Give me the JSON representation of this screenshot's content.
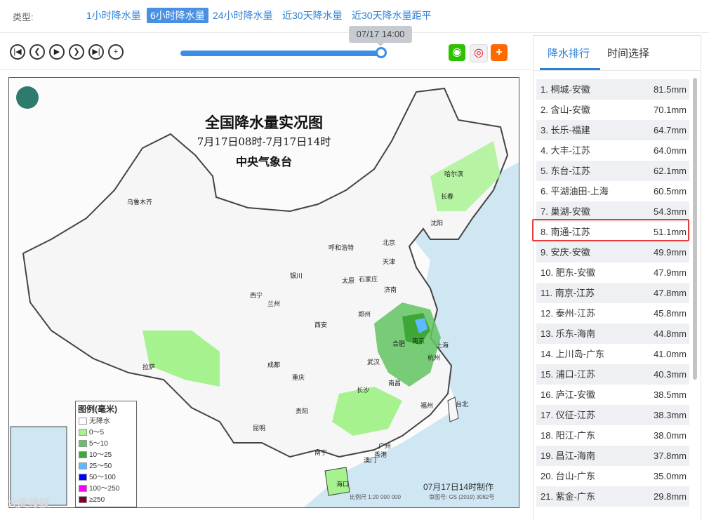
{
  "filter": {
    "label": "类型:",
    "options": [
      {
        "label": "1小时降水量"
      },
      {
        "label": "6小时降水量"
      },
      {
        "label": "24小时降水量"
      },
      {
        "label": "近30天降水量"
      },
      {
        "label": "近30天降水量距平"
      }
    ],
    "active_index": 1
  },
  "player": {
    "time_tooltip": "07/17 14:00",
    "progress": 1.0,
    "controls": [
      "first-icon",
      "prev-icon",
      "play-icon",
      "next-icon",
      "last-icon",
      "zoom-in-icon"
    ]
  },
  "share": {
    "icons": [
      "wechat-icon",
      "weibo-icon",
      "add-icon"
    ],
    "colors": [
      "#2dc100",
      "#e6162d",
      "#ff6a00"
    ]
  },
  "map": {
    "title": "全国降水量实况图",
    "subtitle": "7月17日08时-7月17日14时",
    "agency": "中央气象台",
    "made": "07月17日14时制作",
    "scale": "比例尺 1:20 000 000",
    "review": "审图号: GS (2019) 3082号",
    "legend": {
      "title": "图例(毫米)",
      "items": [
        {
          "label": "无降水",
          "color": "#ffffff"
        },
        {
          "label": "0～5",
          "color": "#a6f28f"
        },
        {
          "label": "5～10",
          "color": "#62c360"
        },
        {
          "label": "10～25",
          "color": "#3da836"
        },
        {
          "label": "25～50",
          "color": "#60b8ff"
        },
        {
          "label": "50～100",
          "color": "#0000fe"
        },
        {
          "label": "100～250",
          "color": "#fa00fa"
        },
        {
          "label": "≥250",
          "color": "#7f0030"
        }
      ]
    },
    "cities": [
      "乌鲁木齐",
      "哈尔滨",
      "长春",
      "沈阳",
      "呼和浩特",
      "北京",
      "天津",
      "石家庄",
      "太原",
      "银川",
      "济南",
      "西宁",
      "兰州",
      "郑州",
      "西安",
      "合肥",
      "南京",
      "上海",
      "拉萨",
      "成都",
      "武汉",
      "杭州",
      "重庆",
      "长沙",
      "南昌",
      "福州",
      "贵阳",
      "台北",
      "昆明",
      "广州",
      "南宁",
      "香港",
      "澳门",
      "海口"
    ]
  },
  "panel": {
    "tabs": [
      {
        "label": "降水排行"
      },
      {
        "label": "时间选择"
      }
    ],
    "rank_list": [
      {
        "name": "1. 桐城-安徽",
        "value": "81.5mm"
      },
      {
        "name": "2. 含山-安徽",
        "value": "70.1mm"
      },
      {
        "name": "3. 长乐-福建",
        "value": "64.7mm"
      },
      {
        "name": "4. 大丰-江苏",
        "value": "64.0mm"
      },
      {
        "name": "5. 东台-江苏",
        "value": "62.1mm"
      },
      {
        "name": "6. 平湖油田-上海",
        "value": "60.5mm"
      },
      {
        "name": "7. 巢湖-安徽",
        "value": "54.3mm"
      },
      {
        "name": "8. 南通-江苏",
        "value": "51.1mm"
      },
      {
        "name": "9. 安庆-安徽",
        "value": "49.9mm"
      },
      {
        "name": "10. 肥东-安徽",
        "value": "47.9mm"
      },
      {
        "name": "11. 南京-江苏",
        "value": "47.8mm"
      },
      {
        "name": "12. 泰州-江苏",
        "value": "45.8mm"
      },
      {
        "name": "13. 乐东-海南",
        "value": "44.8mm"
      },
      {
        "name": "14. 上川岛-广东",
        "value": "41.0mm"
      },
      {
        "name": "15. 浦口-江苏",
        "value": "40.3mm"
      },
      {
        "name": "16. 庐江-安徽",
        "value": "38.5mm"
      },
      {
        "name": "17. 仪征-江苏",
        "value": "38.3mm"
      },
      {
        "name": "18. 阳江-广东",
        "value": "38.0mm"
      },
      {
        "name": "19. 昌江-海南",
        "value": "37.8mm"
      },
      {
        "name": "20. 台山-广东",
        "value": "35.0mm"
      },
      {
        "name": "21. 紫金-广东",
        "value": "29.8mm"
      }
    ],
    "highlighted_index": 7
  },
  "watermark": "大麦辣椒"
}
